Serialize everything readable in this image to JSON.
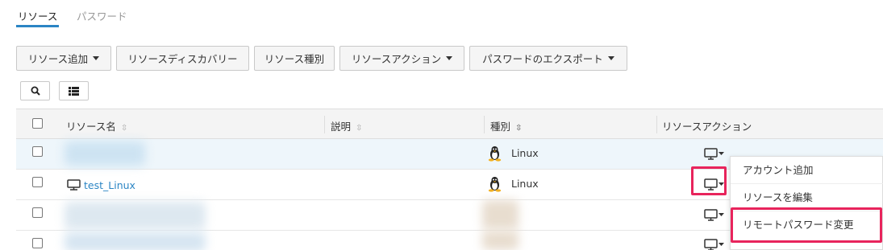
{
  "tabs": [
    {
      "label": "リソース",
      "active": true
    },
    {
      "label": "パスワード",
      "active": false
    }
  ],
  "toolbar": {
    "add_resource": "リソース追加",
    "resource_discovery": "リソースディスカバリー",
    "resource_type": "リソース種別",
    "resource_action": "リソースアクション",
    "password_export": "パスワードのエクスポート"
  },
  "table": {
    "headers": {
      "name": "リソース名",
      "description": "説明",
      "type": "種別",
      "action": "リソースアクション"
    },
    "rows": [
      {
        "name": "",
        "type": "Linux"
      },
      {
        "name": "test_Linux",
        "type": "Linux"
      },
      {
        "name": "",
        "type": ""
      },
      {
        "name": "",
        "type": ""
      }
    ]
  },
  "dropdown": {
    "items": [
      "アカウント追加",
      "リソースを編集",
      "リモートパスワード変更"
    ]
  },
  "colors": {
    "accent": "#2b85c4",
    "highlight": "#e8245c"
  }
}
